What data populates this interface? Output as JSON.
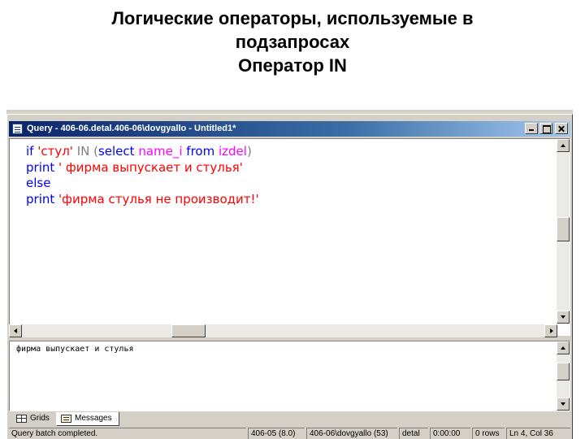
{
  "slide": {
    "title_lines": [
      "Логические операторы, используемые в",
      "подзапросах",
      "Оператор IN"
    ]
  },
  "window": {
    "title": "Query - 406-06.detal.406-06\\dovgyallo - Untitled1*"
  },
  "editor": {
    "lines": [
      [
        {
          "t": "if ",
          "c": "kw"
        },
        {
          "t": "'стул'",
          "c": "str"
        },
        {
          "t": " IN (",
          "c": "op"
        },
        {
          "t": "select ",
          "c": "kw"
        },
        {
          "t": "name_i ",
          "c": "fn"
        },
        {
          "t": "from ",
          "c": "kw"
        },
        {
          "t": "izdel",
          "c": "fn"
        },
        {
          "t": ")",
          "c": "op"
        }
      ],
      [
        {
          "t": "print ",
          "c": "kw"
        },
        {
          "t": "' фирма выпускает и стулья'",
          "c": "str"
        }
      ],
      [
        {
          "t": "else",
          "c": "kw"
        }
      ],
      [
        {
          "t": "print ",
          "c": "kw"
        },
        {
          "t": "'фирма стулья не производит!'",
          "c": "str"
        }
      ]
    ]
  },
  "results": {
    "message": "фирма выпускает и стулья"
  },
  "tabs": {
    "grids": "Grids",
    "messages": "Messages"
  },
  "status": {
    "message": "Query batch completed.",
    "server": "406-05 (8.0)",
    "user": "406-06\\dovgyallo (53)",
    "database": "detal",
    "time": "0:00:00",
    "rows": "0 rows",
    "position": "Ln 4, Col 36"
  },
  "colors": {
    "keyword": "#0000ff",
    "string": "#ff0000",
    "function": "#ff00ff",
    "operator": "#808080",
    "titlebar": "#0a246a"
  }
}
